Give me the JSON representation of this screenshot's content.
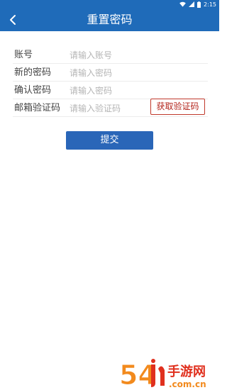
{
  "status_bar": {
    "time": "2:15",
    "icons": [
      "wifi-icon",
      "signal-icon",
      "battery-icon"
    ]
  },
  "header": {
    "title": "重置密码",
    "back_icon": "chevron-left-icon"
  },
  "form": {
    "fields": [
      {
        "label": "账号",
        "placeholder": "请输入账号",
        "value": ""
      },
      {
        "label": "新的密码",
        "placeholder": "请输入密码",
        "value": ""
      },
      {
        "label": "确认密码",
        "placeholder": "请输入密码",
        "value": ""
      },
      {
        "label": "邮箱验证码",
        "placeholder": "请输入验证码",
        "value": ""
      }
    ],
    "get_code_label": "获取验证码",
    "submit_label": "提交"
  },
  "watermark": {
    "text": "54手游网",
    "subtext": ".com.cn"
  },
  "colors": {
    "primary": "#1f6bb9",
    "button": "#2a66b8",
    "accent_red": "#b3241b",
    "watermark_orange": "#f28a1d",
    "watermark_red": "#e0301e"
  }
}
